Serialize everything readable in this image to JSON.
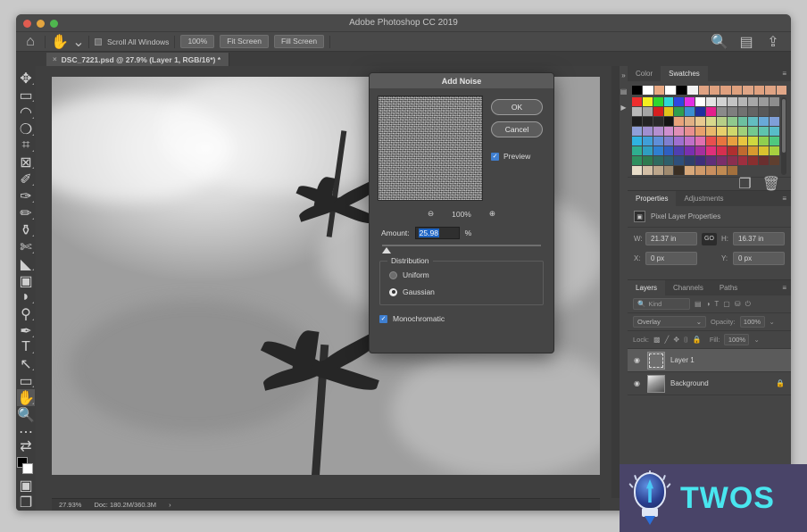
{
  "window": {
    "app_title": "Adobe Photoshop CC 2019"
  },
  "options_bar": {
    "home_icon": "home-icon",
    "tool_icon": "hand-tool-icon",
    "dropdown_icon": "chevron-down-icon",
    "scroll_all_windows_label": "Scroll All Windows",
    "zoom_100_label": "100%",
    "fit_screen_label": "Fit Screen",
    "fill_screen_label": "Fill Screen",
    "search_icon": "search-icon",
    "workspace_icon": "workspace-switcher-icon",
    "share_icon": "share-icon"
  },
  "document_tab": {
    "title": "DSC_7221.psd @ 27.9% (Layer 1, RGB/16*) *",
    "close_icon": "close-icon"
  },
  "toolbar": {
    "tools": [
      {
        "name": "move-tool",
        "glyph": "✥"
      },
      {
        "name": "rectangular-marquee-tool",
        "glyph": "▭"
      },
      {
        "name": "lasso-tool",
        "glyph": "◯"
      },
      {
        "name": "quick-selection-tool",
        "glyph": "❍"
      },
      {
        "name": "crop-tool",
        "glyph": "⌗"
      },
      {
        "name": "frame-tool",
        "glyph": "⊠"
      },
      {
        "name": "eyedropper-tool",
        "glyph": "✎"
      },
      {
        "name": "spot-healing-brush-tool",
        "glyph": "✑"
      },
      {
        "name": "brush-tool",
        "glyph": "✏"
      },
      {
        "name": "clone-stamp-tool",
        "glyph": "⚲"
      },
      {
        "name": "history-brush-tool",
        "glyph": "✂"
      },
      {
        "name": "eraser-tool",
        "glyph": "◣"
      },
      {
        "name": "gradient-tool",
        "glyph": "▢"
      },
      {
        "name": "blur-tool",
        "glyph": "💧"
      },
      {
        "name": "dodge-tool",
        "glyph": "⚯"
      },
      {
        "name": "pen-tool",
        "glyph": "✒"
      },
      {
        "name": "type-tool",
        "glyph": "T"
      },
      {
        "name": "path-selection-tool",
        "glyph": "↖"
      },
      {
        "name": "rectangle-tool",
        "glyph": "▭"
      },
      {
        "name": "hand-tool",
        "glyph": "✋"
      },
      {
        "name": "zoom-tool",
        "glyph": "🔍"
      },
      {
        "name": "edit-toolbar-tool",
        "glyph": "⋯"
      },
      {
        "name": "default-colors-tool",
        "glyph": "⧉"
      }
    ],
    "quick_mask_icon": "quick-mask-icon",
    "screen_mode_icon": "screen-mode-icon"
  },
  "status_bar": {
    "zoom": "27.93%",
    "doc_size": "Doc: 180.2M/360.3M",
    "arrow": "›"
  },
  "dialog": {
    "title": "Add Noise",
    "ok_label": "OK",
    "cancel_label": "Cancel",
    "preview_label": "Preview",
    "preview_checked": true,
    "zoom_out_icon": "zoom-out-icon",
    "zoom_level": "100%",
    "zoom_in_icon": "zoom-in-icon",
    "amount_label": "Amount:",
    "amount_value": "25.98",
    "amount_unit": "%",
    "distribution_label": "Distribution",
    "uniform_label": "Uniform",
    "gaussian_label": "Gaussian",
    "distribution_selected": "Gaussian",
    "monochromatic_label": "Monochromatic",
    "monochromatic_checked": true
  },
  "right_dock": {
    "rail_icons": [
      "panel-expand-icon",
      "history-icon",
      "play-icon"
    ],
    "color_panel": {
      "tabs": [
        "Color",
        "Swatches"
      ],
      "active_tab": "Swatches",
      "menu_icon": "panel-menu-icon",
      "new_swatch_icon": "new-swatch-icon",
      "delete_swatch_icon": "trash-icon",
      "top_row": [
        "#000000",
        "#ffffff",
        "#e8a882",
        "#ffffff",
        "#000000",
        "#f2f2f2",
        "#e0a383",
        "#dfa17f",
        "#e0a07e",
        "#dea07d",
        "#dfa586",
        "#e0a17f",
        "#dfa383",
        "#e1a788"
      ],
      "grid": [
        [
          "#ef2d2d",
          "#f3ef20",
          "#2fd62f",
          "#2fd6d6",
          "#2f46e0",
          "#e32fe3",
          "#ffffff",
          "#e3e3e3",
          "#d2d2d2",
          "#c3c3c3",
          "#b5b5b5",
          "#a7a7a7",
          "#9a9a9a",
          "#8d8d8d"
        ],
        [
          "#b9b9b9",
          "#a5a5a5",
          "#d61f1f",
          "#e0c31b",
          "#2f9e4f",
          "#3a8fd0",
          "#1f2f9e",
          "#e31f8c",
          "#8a8a8a",
          "#7e7e7e",
          "#717171",
          "#646464",
          "#585858",
          "#4b4b4b"
        ],
        [
          "#1e1e1e",
          "#242424",
          "#2a2a2a",
          "#151515",
          "#e8a37a",
          "#e0b084",
          "#e8c98f",
          "#d8d98c",
          "#b6cf87",
          "#8fc98d",
          "#6cc0a0",
          "#63bdc0",
          "#69a9d8",
          "#7f9fd8"
        ],
        [
          "#8f9fd8",
          "#a08fd0",
          "#b58fd0",
          "#cf8fcf",
          "#e08fb6",
          "#e88f8f",
          "#e8a06b",
          "#e8b86b",
          "#e8d06b",
          "#cfd86b",
          "#9fd07a",
          "#74c98f",
          "#5fc3ad",
          "#58bcc8"
        ],
        [
          "#2fb3e0",
          "#3f9fd8",
          "#5f8fd8",
          "#7f7fd0",
          "#9f6fd0",
          "#c06fc8",
          "#e06fb0",
          "#e84f4f",
          "#e8743f",
          "#e8a03f",
          "#e8c53f",
          "#cfd83f",
          "#8fcf4f",
          "#4fc87f"
        ],
        [
          "#2fae8f",
          "#2f9ec0",
          "#2f7fd0",
          "#2f5fc0",
          "#4f3fb0",
          "#7a2fb0",
          "#a52f9e",
          "#e02f7a",
          "#d62f4f",
          "#b02f2f",
          "#c06a2f",
          "#d89a2f",
          "#d8c22f",
          "#a8cf3f"
        ],
        [
          "#2f8f5f",
          "#2f7a4f",
          "#2f6a5f",
          "#2f5f6a",
          "#2f4f7a",
          "#2f3f6a",
          "#3f2f7a",
          "#5f2f7a",
          "#7a2f6a",
          "#8a2f4f",
          "#9e2f3f",
          "#8a2f2f",
          "#6a2f2f",
          "#5f3f2f"
        ],
        [
          "#e8ddc9",
          "#d3bfa6",
          "#bda78c",
          "#a08b70",
          "#3a2f24",
          "#d8a87a",
          "#d09a6a",
          "#c98f5f",
          "#c08a52",
          "#a3703d",
          "#454545",
          "#454545",
          "#454545",
          "#454545"
        ]
      ]
    },
    "properties_panel": {
      "tabs": [
        "Properties",
        "Adjustments"
      ],
      "active_tab": "Properties",
      "menu_icon": "panel-menu-icon",
      "header_label": "Pixel Layer Properties",
      "thumb_icon": "pixel-layer-icon",
      "w_label": "W:",
      "w_value": "21.37 in",
      "link_label": "GO",
      "h_label": "H:",
      "h_value": "16.37 in",
      "x_label": "X:",
      "x_value": "0 px",
      "y_label": "Y:",
      "y_value": "0 px"
    },
    "layers_panel": {
      "tabs": [
        "Layers",
        "Channels",
        "Paths"
      ],
      "active_tab": "Layers",
      "menu_icon": "panel-menu-icon",
      "filter_label": "Kind",
      "filter_icons": [
        "pixel-filter-icon",
        "adjustment-filter-icon",
        "type-filter-icon",
        "shape-filter-icon",
        "smart-object-filter-icon",
        "toggle-filter-icon"
      ],
      "blend_mode": "Overlay",
      "opacity_label": "Opacity:",
      "opacity_value": "100%",
      "lock_label": "Lock:",
      "lock_icons": [
        "lock-transparent-icon",
        "lock-image-icon",
        "lock-position-icon",
        "lock-artboard-icon",
        "lock-all-icon"
      ],
      "fill_label": "Fill:",
      "fill_value": "100%",
      "layers": [
        {
          "name": "Layer 1",
          "visible": true,
          "locked": false,
          "selected": true
        },
        {
          "name": "Background",
          "visible": true,
          "locked": true,
          "selected": false
        }
      ],
      "eye_icon": "eye-icon",
      "lock_icon": "lock-icon"
    }
  },
  "watermark": {
    "text": "TWOS",
    "logo_icon": "lightbulb-icon",
    "bg": "#494468",
    "accent": "#49e6ef"
  }
}
